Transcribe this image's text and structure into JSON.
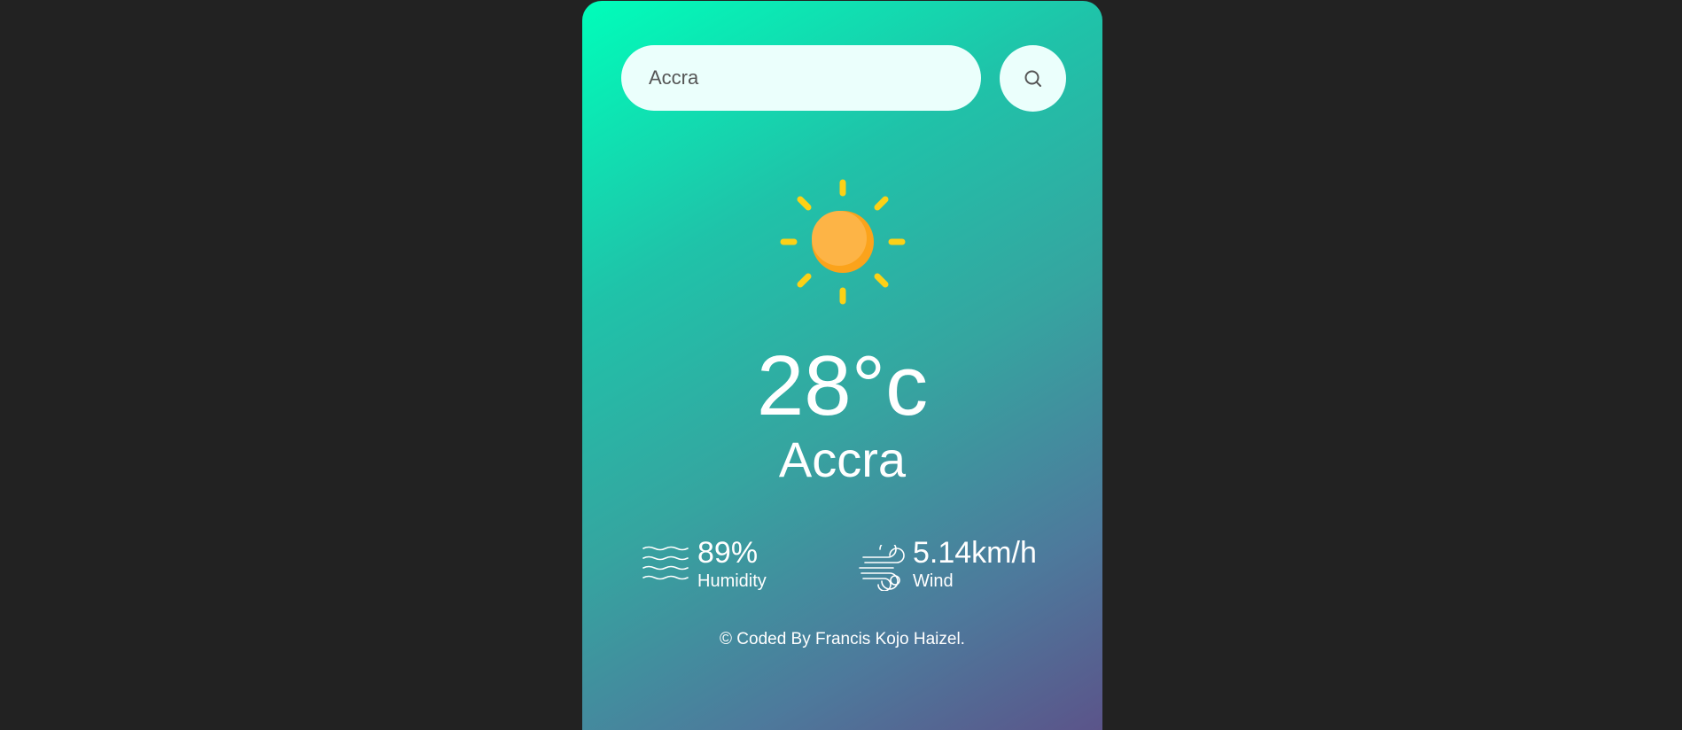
{
  "search": {
    "value": "Accra",
    "button_icon": "search-icon"
  },
  "weather": {
    "icon": "sun-icon",
    "temperature": "28°c",
    "city": "Accra"
  },
  "details": {
    "humidity": {
      "icon": "humidity-waves-icon",
      "value": "89%",
      "label": "Humidity"
    },
    "wind": {
      "icon": "wind-icon",
      "value": "5.14km/h",
      "label": "Wind"
    }
  },
  "footer": {
    "credit": "© Coded By Francis Kojo Haizel."
  },
  "colors": {
    "page_background": "#222222",
    "gradient_start": "#00feba",
    "gradient_end": "#5b548a",
    "input_background": "#ebfffc",
    "sun_core": "#fbad3f",
    "sun_rays": "#fcd116"
  }
}
